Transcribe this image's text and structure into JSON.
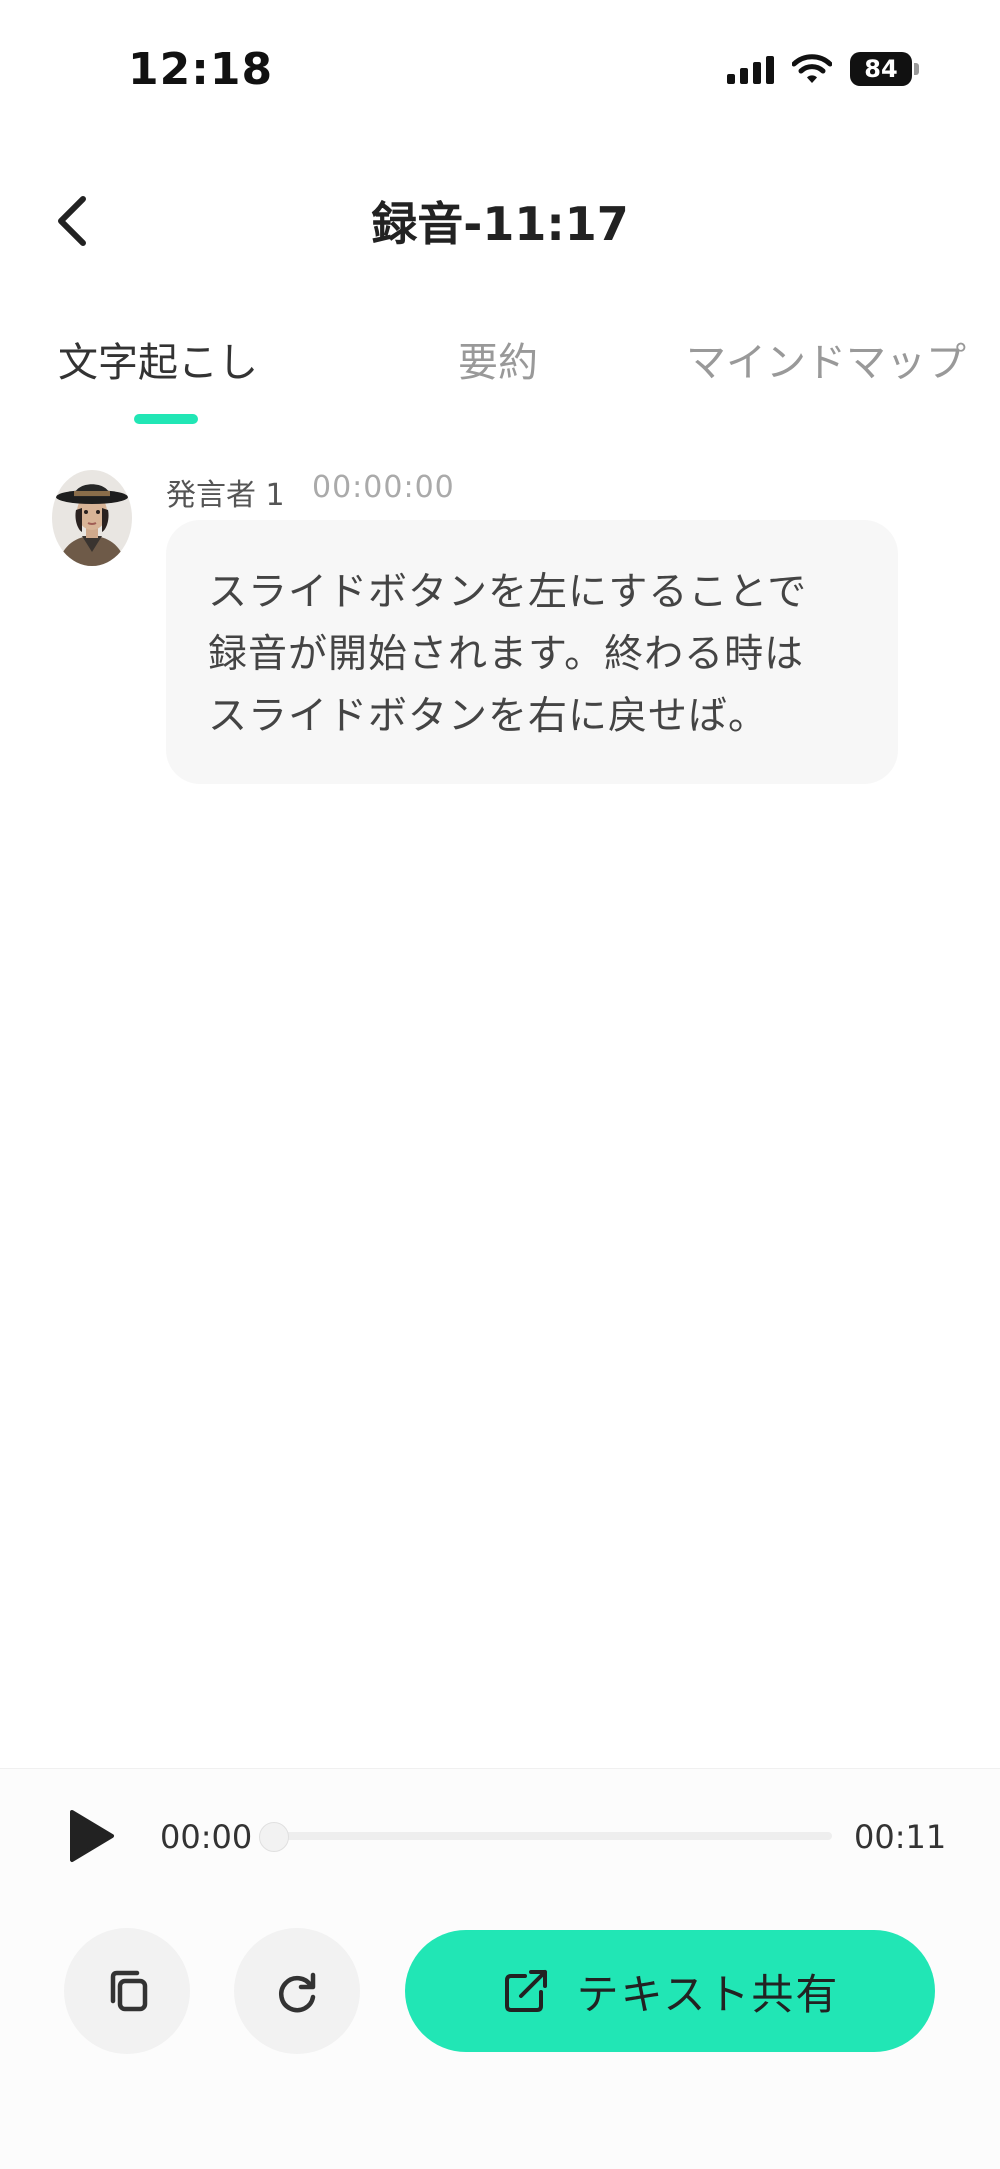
{
  "status_bar": {
    "time": "12:18",
    "battery": "84"
  },
  "header": {
    "title": "録音-11:17"
  },
  "tabs": [
    {
      "label": "文字起こし",
      "active": true
    },
    {
      "label": "要約",
      "active": false
    },
    {
      "label": "マインドマップ",
      "active": false
    }
  ],
  "transcript": [
    {
      "speaker": "発言者 1",
      "timestamp": "00:00:00",
      "lines": [
        "スライドボタンを左にすることで",
        "録音が開始されます。終わる時は",
        "スライドボタンを右に戻せば。"
      ]
    }
  ],
  "player": {
    "current_time": "00:00",
    "total_time": "00:11",
    "progress": 0
  },
  "actions": {
    "share_label": "テキスト共有"
  },
  "icons": {
    "back": "chevron-left-icon",
    "play": "play-icon",
    "copy": "copy-icon",
    "redo": "redo-icon",
    "share": "share-icon"
  },
  "colors": {
    "accent": "#21E6B5",
    "bubble": "#F7F7F7"
  }
}
